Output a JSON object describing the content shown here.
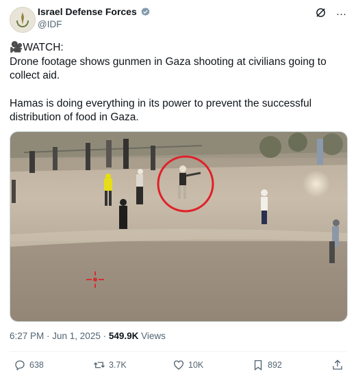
{
  "author": {
    "display_name": "Israel Defense Forces",
    "handle": "@IDF"
  },
  "post": {
    "emoji": "🎥",
    "line1": "WATCH:",
    "line2": "Drone footage shows gunmen in Gaza shooting at civilians going to collect aid.",
    "line3": "Hamas is doing everything in its power to prevent the successful distribution of food in Gaza."
  },
  "meta": {
    "time": "6:27 PM · Jun 1, 2025 · ",
    "views_count": "549.9K",
    "views_label": " Views"
  },
  "actions": {
    "replies": "638",
    "reposts": "3.7K",
    "likes": "10K",
    "bookmarks": "892"
  },
  "colors": {
    "text": "#0f1419",
    "secondary": "#536471",
    "verified": "#1d9bf0",
    "highlight_circle": "#e0202a"
  }
}
